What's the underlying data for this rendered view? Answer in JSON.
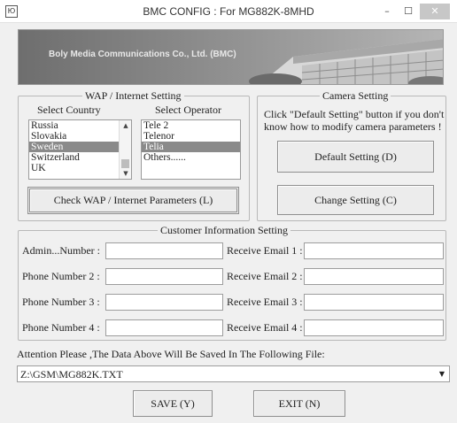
{
  "window": {
    "title": "BMC CONFIG : For MG882K-8MHD",
    "app_icon": "app-icon",
    "minimize_symbol": "–",
    "maximize_symbol": "☐",
    "close_symbol": "✕"
  },
  "banner": {
    "company": "Boly Media Communications Co., Ltd.  (BMC)"
  },
  "wap": {
    "group_title": "WAP / Internet Setting",
    "country_label": "Select Country",
    "operator_label": "Select Operator",
    "countries": [
      "Russia",
      "Slovakia",
      "Sweden",
      "Switzerland",
      "UK"
    ],
    "countries_selected": "Sweden",
    "operators": [
      "Tele 2",
      "Telenor",
      "Telia",
      "Others......"
    ],
    "operators_selected": "Telia",
    "check_button": "Check WAP / Internet Parameters (L)"
  },
  "camera": {
    "group_title": "Camera Setting",
    "hint": "Click \"Default Setting\" button if you don't know how to modify camera parameters !",
    "default_button": "Default Setting (D)",
    "change_button": "Change Setting (C)"
  },
  "customer": {
    "group_title": "Customer Information Setting",
    "rows": [
      {
        "phone_label": "Admin...Number :",
        "phone_value": "",
        "email_label": "Receive Email 1 :",
        "email_value": ""
      },
      {
        "phone_label": "Phone Number 2 :",
        "phone_value": "",
        "email_label": "Receive Email 2 :",
        "email_value": ""
      },
      {
        "phone_label": "Phone Number 3 :",
        "phone_value": "",
        "email_label": "Receive Email 3 :",
        "email_value": ""
      },
      {
        "phone_label": "Phone Number 4 :",
        "phone_value": "",
        "email_label": "Receive Email 4 :",
        "email_value": ""
      }
    ]
  },
  "save_notice": "Attention Please ,The Data Above Will Be Saved In The Following  File:",
  "file_path": "Z:\\GSM\\MG882K.TXT",
  "actions": {
    "save": "SAVE (Y)",
    "exit": "EXIT (N)"
  }
}
